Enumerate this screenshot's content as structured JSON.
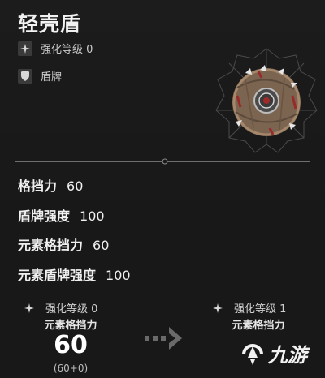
{
  "item": {
    "name": "轻壳盾",
    "enhance_level": "强化等级 0",
    "category": "盾牌"
  },
  "stats": [
    {
      "label": "格挡力",
      "value": "60"
    },
    {
      "label": "盾牌强度",
      "value": "100"
    },
    {
      "label": "元素格挡力",
      "value": "60"
    },
    {
      "label": "元素盾牌强度",
      "value": "100"
    }
  ],
  "upgrade": {
    "current": {
      "level_label": "强化等级 0",
      "stat_label": "元素格挡力",
      "value": "60",
      "formula": "(60+0)"
    },
    "next": {
      "level_label": "强化等级 1",
      "stat_label": "元素格挡力"
    }
  },
  "watermark": {
    "text": "九游"
  },
  "icons": [
    "sparkle-icon",
    "shield-icon",
    "arrow-right-icon",
    "logo-icon"
  ]
}
